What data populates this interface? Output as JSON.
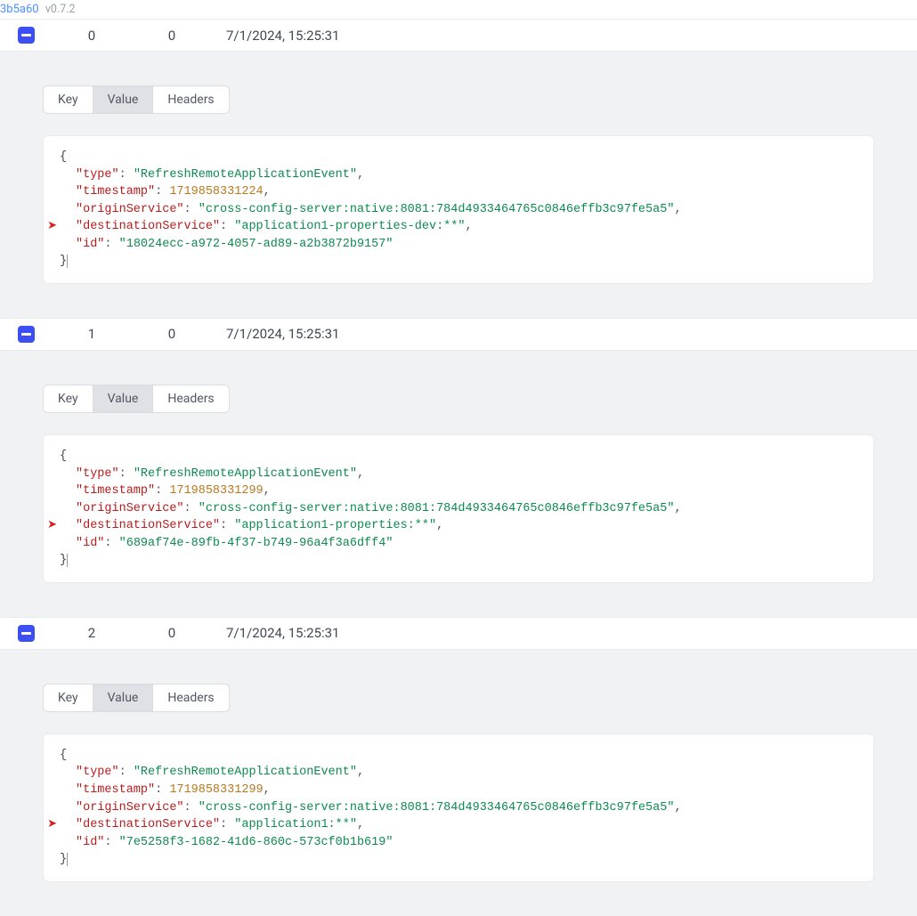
{
  "header": {
    "hash": "3b5a60",
    "version": "v0.7.2"
  },
  "tab_labels": {
    "key": "Key",
    "value": "Value",
    "headers": "Headers"
  },
  "records": [
    {
      "index": "0",
      "partition": "0",
      "timestamp": "7/1/2024, 15:25:31",
      "json": {
        "type": "RefreshRemoteApplicationEvent",
        "timestamp": "1719858331224",
        "originService": "cross-config-server:native:8081:784d4933464765c0846effb3c97fe5a5",
        "destinationService": "application1-properties-dev:**",
        "id": "18024ecc-a972-4057-ad89-a2b3872b9157"
      }
    },
    {
      "index": "1",
      "partition": "0",
      "timestamp": "7/1/2024, 15:25:31",
      "json": {
        "type": "RefreshRemoteApplicationEvent",
        "timestamp": "1719858331299",
        "originService": "cross-config-server:native:8081:784d4933464765c0846effb3c97fe5a5",
        "destinationService": "application1-properties:**",
        "id": "689af74e-89fb-4f37-b749-96a4f3a6dff4"
      }
    },
    {
      "index": "2",
      "partition": "0",
      "timestamp": "7/1/2024, 15:25:31",
      "json": {
        "type": "RefreshRemoteApplicationEvent",
        "timestamp": "1719858331299",
        "originService": "cross-config-server:native:8081:784d4933464765c0846effb3c97fe5a5",
        "destinationService": "application1:**",
        "id": "7e5258f3-1682-41d6-860c-573cf0b1b619"
      }
    }
  ]
}
